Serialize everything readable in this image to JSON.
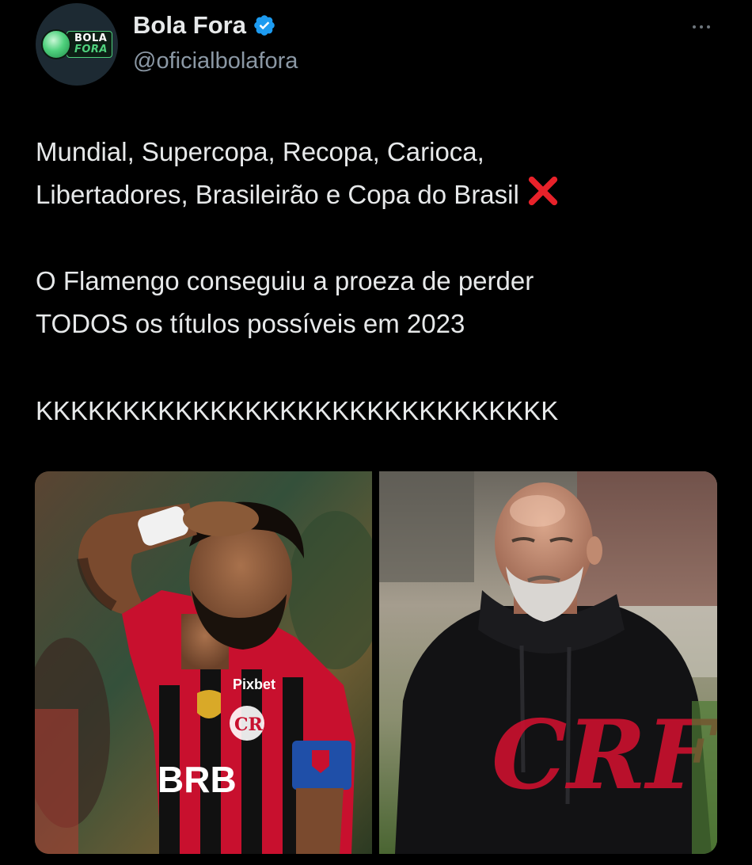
{
  "account": {
    "name": "Bola Fora",
    "handle": "@oficialbolafora",
    "avatar_word_1": "BOLA",
    "avatar_word_2": "FORA",
    "verified": true,
    "verified_color": "#1d9bf0"
  },
  "tweet": {
    "line_1": "Mundial, Supercopa, Recopa, Carioca,",
    "line_2": "Libertadores, Brasileirão e Copa do Brasil",
    "line_3": "O Flamengo conseguiu a proeza de perder",
    "line_4": "TODOS os títulos possíveis em 2023",
    "line_5": "KKKKKKKKKKKKKKKKKKKKKKKKKKKKKK",
    "emoji": "cross-mark-icon"
  },
  "media": {
    "left_photo": {
      "description_icon": "player-photo",
      "jersey_text": "BRB",
      "sponsor": "Pixbet"
    },
    "right_photo": {
      "description_icon": "coach-photo",
      "crest": "CRF"
    }
  },
  "colors": {
    "background": "#000000",
    "text": "#e7e9ea",
    "secondary": "#8b98a5",
    "cross": "#e8222a",
    "flamengo_red": "#c8102e"
  }
}
